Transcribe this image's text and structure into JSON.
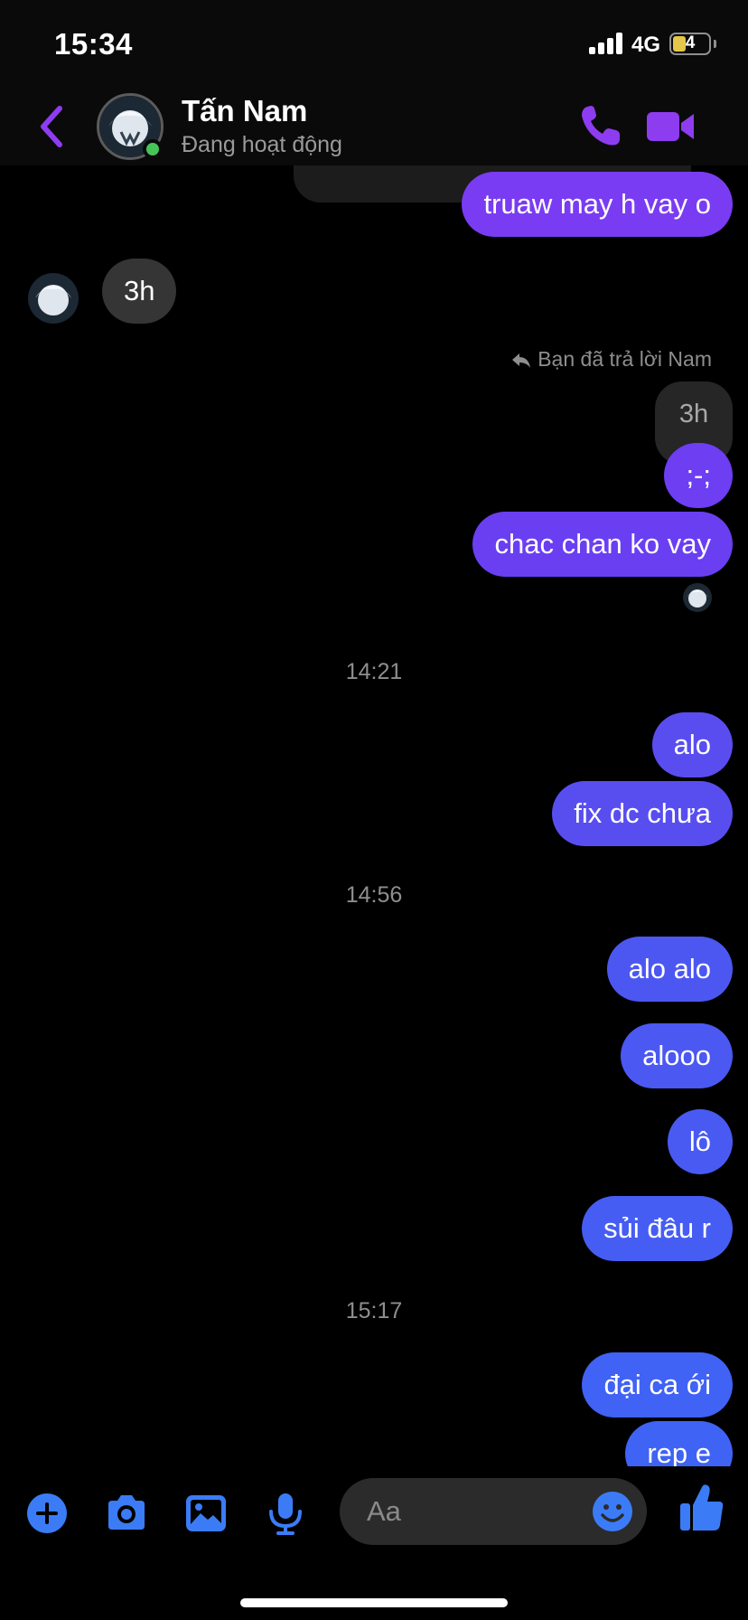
{
  "status_bar": {
    "time": "15:34",
    "network": "4G",
    "battery": "4"
  },
  "header": {
    "name": "Tấn Nam",
    "status": "Đang hoạt động"
  },
  "messages": {
    "m1": "truaw may h vay o",
    "m2": "3h",
    "reply_note": "Bạn đã trả lời Nam",
    "quoted": "3h",
    "m3": ";-;",
    "m4": "chac chan ko vay",
    "t1": "14:21",
    "m5": "alo",
    "m6": "fix dc chưa",
    "t2": "14:56",
    "m7": "alo alo",
    "m8": "alooo",
    "m9": "lô",
    "m10": "sủi đâu r",
    "t3": "15:17",
    "m11": "đại ca ới",
    "m12": "rep e"
  },
  "composer": {
    "placeholder": "Aa"
  },
  "colors": {
    "accent": "#8e3cf0",
    "blue": "#3b7cf6",
    "bubble_purple": "#7a3cf2",
    "bubble_indigo": "#5a4df0",
    "bubble_blue": "#3f63f5"
  },
  "icons": [
    "back-icon",
    "phone-icon",
    "video-icon",
    "plus-icon",
    "camera-icon",
    "image-icon",
    "mic-icon",
    "emoji-icon",
    "thumbs-up-icon",
    "reply-icon"
  ]
}
